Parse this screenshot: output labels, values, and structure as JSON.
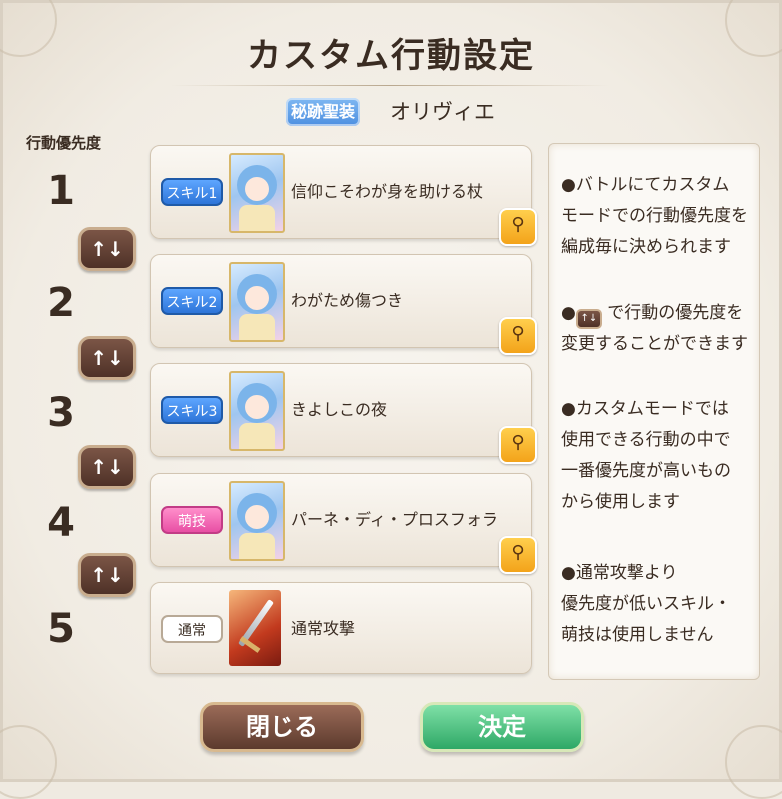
{
  "title": "カスタム行動設定",
  "character": {
    "badge": "秘跡聖装",
    "name": "オリヴィエ"
  },
  "priority_label": "行動優先度",
  "swap_label": "↑↓",
  "rows": [
    {
      "number": "1",
      "tag": "スキル1",
      "tag_type": "skill",
      "name": "信仰こそわが身を助ける杖",
      "icon": "character-portrait-icon",
      "detail": true
    },
    {
      "number": "2",
      "tag": "スキル2",
      "tag_type": "skill",
      "name": "わがため傷つき",
      "icon": "character-portrait-icon",
      "detail": true
    },
    {
      "number": "3",
      "tag": "スキル3",
      "tag_type": "skill",
      "name": "きよしこの夜",
      "icon": "character-portrait-icon",
      "detail": true
    },
    {
      "number": "4",
      "tag": "萌技",
      "tag_type": "moe",
      "name": "パーネ・ディ・プロスフォラ",
      "icon": "character-portrait-icon",
      "detail": true
    },
    {
      "number": "5",
      "tag": "通常",
      "tag_type": "normal",
      "name": "通常攻撃",
      "icon": "sword-icon",
      "detail": false
    }
  ],
  "help": {
    "p1": "●バトルにてカスタム\nモードでの行動優先度を\n編成毎に決められます",
    "p2_pre": "●",
    "p2_post": "で行動の優先度を\n変更することができます",
    "p3": "●カスタムモードでは\n使用できる行動の中で\n一番優先度が高いもの\nから使用します",
    "p4": "●通常攻撃より\n優先度が低いスキル・\n萌技は使用しません"
  },
  "buttons": {
    "close": "閉じる",
    "confirm": "決定"
  },
  "colors": {
    "skill_tag": "#2d74d8",
    "moe_tag": "#e84fa4",
    "confirm": "#2ea866",
    "close": "#5c3a2d",
    "detail": "#f3a31a"
  }
}
